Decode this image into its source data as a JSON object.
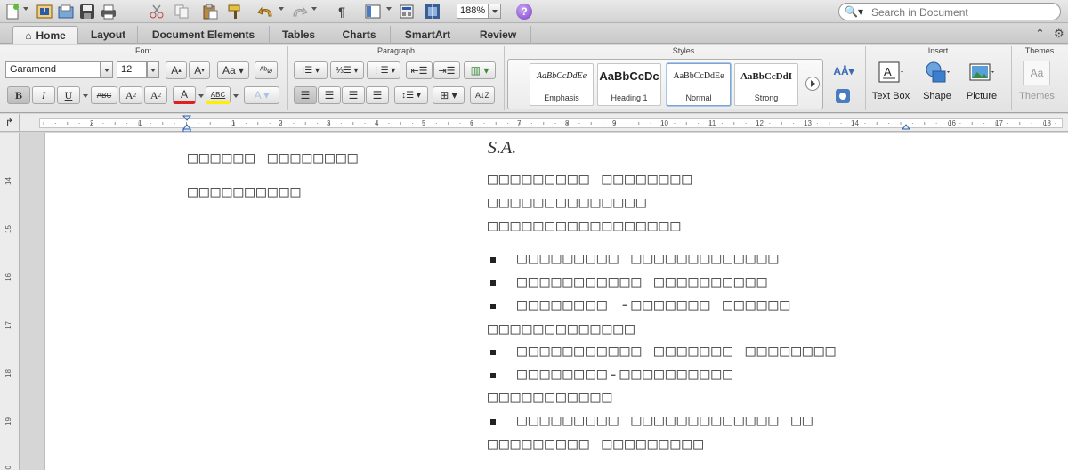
{
  "toolbar": {
    "zoom": "188%",
    "search_placeholder": "Search in Document"
  },
  "tabs": [
    "Home",
    "Layout",
    "Document Elements",
    "Tables",
    "Charts",
    "SmartArt",
    "Review"
  ],
  "ribbon": {
    "groups": {
      "font": "Font",
      "paragraph": "Paragraph",
      "styles": "Styles",
      "insert": "Insert",
      "themes": "Themes"
    },
    "font_name": "Garamond",
    "font_size": "12",
    "styles": [
      {
        "sample": "AaBbCcDdEe",
        "label": "Emphasis"
      },
      {
        "sample": "AaBbCcDc",
        "label": "Heading 1"
      },
      {
        "sample": "AaBbCcDdEe",
        "label": "Normal"
      },
      {
        "sample": "AaBbCcDdI",
        "label": "Strong"
      }
    ],
    "insert": [
      "Text Box",
      "Shape",
      "Picture"
    ],
    "themes_label": "Themes",
    "themes_sample": "Aa"
  },
  "ruler": {
    "numbers": [
      "2",
      "1",
      "1",
      "2",
      "3",
      "4",
      "5",
      "6",
      "7",
      "8",
      "9",
      "10",
      "11",
      "12",
      "13",
      "14",
      "16",
      "17",
      "18"
    ],
    "vnumbers": [
      "14",
      "15",
      "16",
      "17",
      "18",
      "19",
      "20"
    ]
  },
  "document": {
    "title": "S.A.",
    "left_col": [
      "□□□□□□ □□□□□□□□",
      "□□□□□□□□□□"
    ],
    "para": [
      "□□□□□□□□□ □□□□□□□□",
      "□□□□□□□□□□□□□□",
      "□□□□□□□□□□□□□□□□□"
    ],
    "bullets": [
      {
        "text": "□□□□□□□□□ □□□□□□□□□□□□□",
        "cont": ""
      },
      {
        "text": "□□□□□□□□□□□ □□□□□□□□□□",
        "cont": ""
      },
      {
        "text": "□□□□□□□□ -□□□□□□□ □□□□□□",
        "cont": "□□□□□□□□□□□□□"
      },
      {
        "text": "□□□□□□□□□□□ □□□□□□□ □□□□□□□□",
        "cont": ""
      },
      {
        "text": "□□□□□□□□-□□□□□□□□□□",
        "cont": "□□□□□□□□□□□"
      },
      {
        "text": "□□□□□□□□□ □□□□□□□□□□□□□ □□",
        "cont": "□□□□□□□□□ □□□□□□□□□"
      }
    ]
  }
}
